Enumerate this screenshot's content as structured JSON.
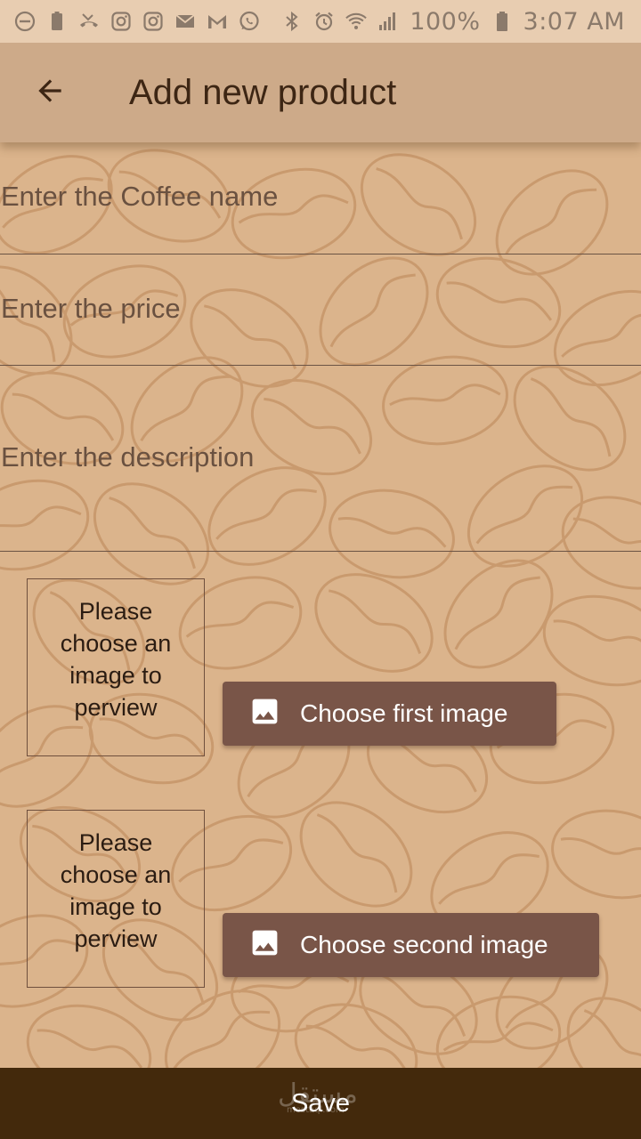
{
  "status_bar": {
    "battery_percent": "100%",
    "time": "3:07 AM",
    "left_icons": [
      "do-not-disturb-icon",
      "battery-saver-icon",
      "missed-call-icon",
      "instagram-icon",
      "instagram-icon",
      "email-icon",
      "gmail-icon",
      "whatsapp-icon"
    ],
    "right_icons": [
      "bluetooth-icon",
      "alarm-icon",
      "wifi-icon",
      "signal-icon",
      "battery-icon"
    ]
  },
  "app_bar": {
    "back_icon": "arrow-back-icon",
    "title": "Add new product"
  },
  "form": {
    "name_placeholder": "Enter the Coffee name",
    "price_placeholder": "Enter the price",
    "description_placeholder": "Enter the description"
  },
  "images": [
    {
      "preview_text": "Please choose an image to perview",
      "button_label": "Choose first image",
      "button_icon": "image-icon"
    },
    {
      "preview_text": "Please choose an image to perview",
      "button_label": "Choose second image",
      "button_icon": "image-icon"
    }
  ],
  "save_button": {
    "label": "Save"
  },
  "watermark": {
    "text": "مستقل",
    "subtext": "mostaql.com"
  },
  "colors": {
    "background": "#dbb48c",
    "app_bar": "#cdaa89",
    "status_bar": "#e8cdb1",
    "button": "#795548",
    "save_bar": "#43290c",
    "title_text": "#3d2614"
  }
}
